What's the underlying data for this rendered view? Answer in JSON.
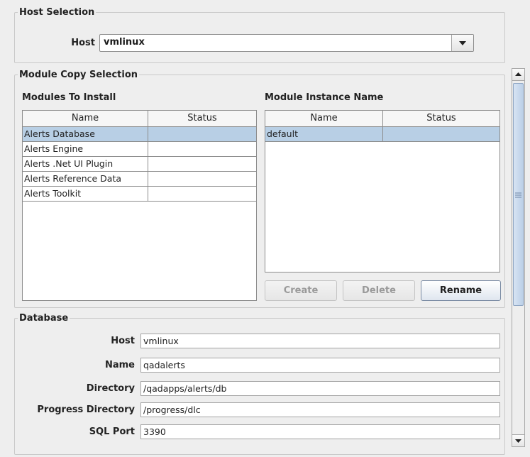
{
  "host_selection": {
    "legend": "Host Selection",
    "host_label": "Host",
    "host_value": "vmlinux"
  },
  "module_copy": {
    "legend": "Module Copy Selection",
    "modules_title": "Modules To Install",
    "modules_columns": [
      "Name",
      "Status"
    ],
    "modules": [
      {
        "name": "Alerts Database",
        "status": "",
        "selected": true
      },
      {
        "name": "Alerts Engine",
        "status": "",
        "selected": false
      },
      {
        "name": "Alerts .Net UI Plugin",
        "status": "",
        "selected": false
      },
      {
        "name": "Alerts Reference Data",
        "status": "",
        "selected": false
      },
      {
        "name": "Alerts Toolkit",
        "status": "",
        "selected": false
      }
    ],
    "instance_title": "Module Instance Name",
    "instance_columns": [
      "Name",
      "Status"
    ],
    "instances": [
      {
        "name": "default",
        "status": "",
        "selected": true
      }
    ],
    "create_label": "Create",
    "delete_label": "Delete",
    "rename_label": "Rename"
  },
  "database": {
    "legend": "Database",
    "host_label": "Host",
    "host_value": "vmlinux",
    "name_label": "Name",
    "name_value": "qadalerts",
    "directory_label": "Directory",
    "directory_value": "/qadapps/alerts/db",
    "progress_label": "Progress Directory",
    "progress_value": "/progress/dlc",
    "sqlport_label": "SQL Port",
    "sqlport_value": "3390"
  },
  "icons": {
    "dropdown": "chevron-down-icon",
    "scroll_up": "arrow-up-icon",
    "scroll_down": "arrow-down-icon",
    "scroll_grip": "grip-icon"
  }
}
